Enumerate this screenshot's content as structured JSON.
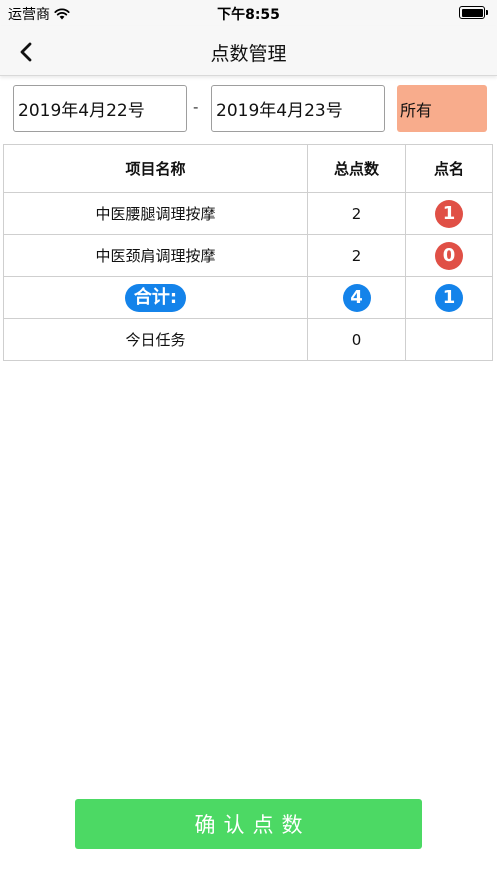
{
  "status_bar": {
    "carrier": "运营商",
    "time": "下午8:55"
  },
  "nav": {
    "title": "点数管理"
  },
  "filters": {
    "start_date": "2019年4月22号",
    "separator": "-",
    "end_date": "2019年4月23号",
    "category": "所有"
  },
  "table": {
    "headers": [
      "项目名称",
      "总点数",
      "点名"
    ],
    "rows": [
      {
        "name": "中医腰腿调理按摩",
        "total": "2",
        "named": "1"
      },
      {
        "name": "中医颈肩调理按摩",
        "total": "2",
        "named": "0"
      }
    ],
    "summary": {
      "label": "合计:",
      "total": "4",
      "named": "1"
    },
    "task": {
      "name": "今日任务",
      "total": "0",
      "named": ""
    }
  },
  "colors": {
    "badge_red": "#e05046",
    "badge_blue": "#1483ea",
    "confirm_green": "#4cd964",
    "filter_orange": "#f8ac8c"
  },
  "icons": {
    "back": "chevron-left-icon",
    "wifi": "wifi-icon",
    "battery": "battery-icon"
  },
  "actions": {
    "confirm_label": "确认点数"
  }
}
